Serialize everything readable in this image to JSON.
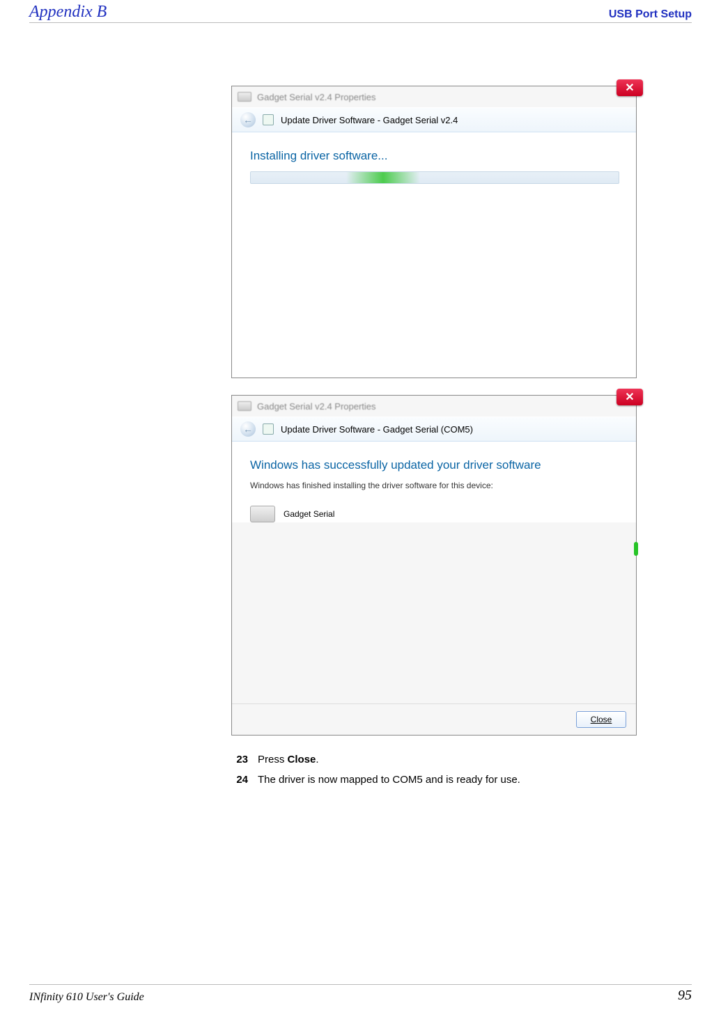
{
  "header": {
    "left": "Appendix B",
    "right": "USB Port Setup"
  },
  "fig1": {
    "fake_title": "Gadget Serial v2.4 Properties",
    "wizard_title": "Update Driver Software - Gadget Serial v2.4",
    "heading": "Installing driver software..."
  },
  "fig2": {
    "fake_title": "Gadget Serial v2.4 Properties",
    "wizard_title": "Update Driver Software - Gadget Serial (COM5)",
    "heading": "Windows has successfully updated your driver software",
    "note": "Windows has finished installing the driver software for this device:",
    "device_name": "Gadget Serial",
    "close_label": "Close"
  },
  "steps": [
    {
      "num": "23",
      "text_parts": [
        "Press ",
        "Close",
        "."
      ]
    },
    {
      "num": "24",
      "text": "The driver is now mapped to COM5 and is ready for use."
    }
  ],
  "footer": {
    "left_prefix": "IN",
    "left_italic": "finity",
    "left_suffix": " 610 User's Guide",
    "page": "95"
  }
}
